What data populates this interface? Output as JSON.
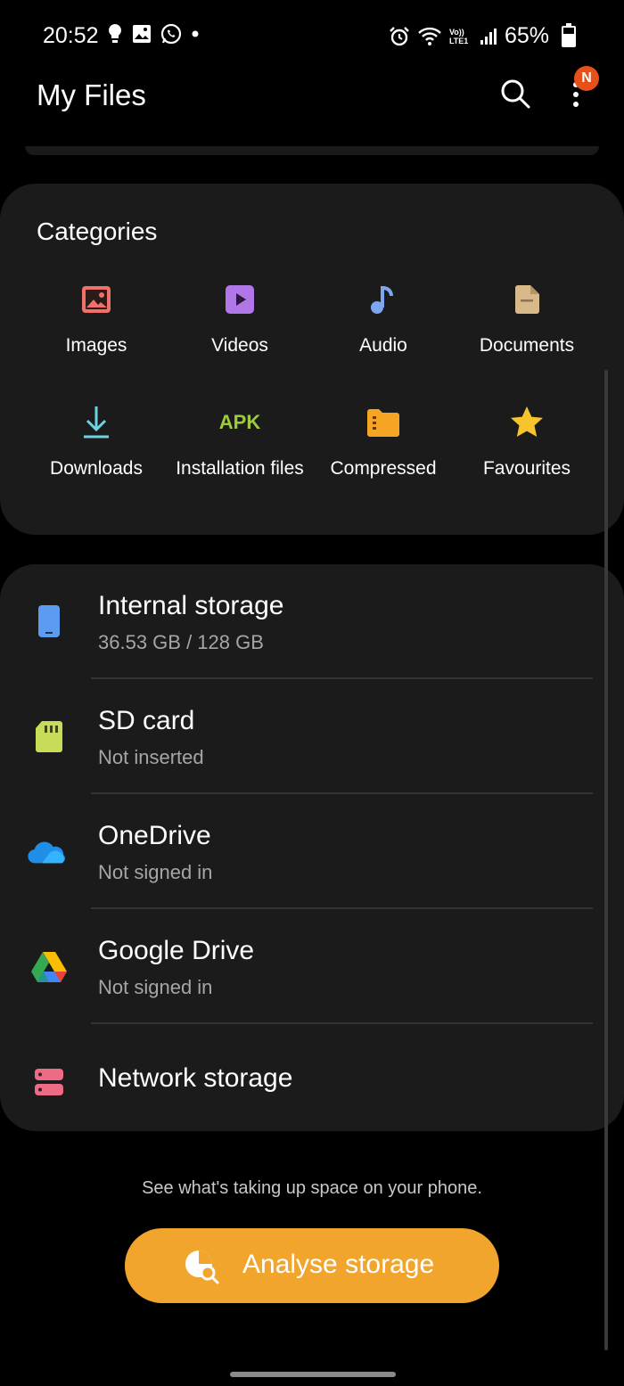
{
  "status_bar": {
    "time": "20:52",
    "battery": "65%",
    "battery_level": 0.65,
    "icons_left": [
      "bulb-icon",
      "gallery-icon",
      "whatsapp-icon",
      "dot-icon"
    ],
    "icons_right": [
      "alarm-icon",
      "wifi-icon",
      "volte-icon",
      "signal-icon",
      "battery-icon"
    ],
    "volte_text": "Vo)) LTE1"
  },
  "appbar": {
    "title": "My Files",
    "badge": "N"
  },
  "categories": {
    "title": "Categories",
    "items": [
      {
        "label": "Images",
        "icon": "image-icon",
        "color": "#f0706a"
      },
      {
        "label": "Videos",
        "icon": "video-icon",
        "color": "#b176e8"
      },
      {
        "label": "Audio",
        "icon": "music-note-icon",
        "color": "#7ea6f0"
      },
      {
        "label": "Documents",
        "icon": "document-icon",
        "color": "#d9b98a"
      },
      {
        "label": "Downloads",
        "icon": "download-icon",
        "color": "#6fd1e4"
      },
      {
        "label": "Installation files",
        "icon": "apk-icon",
        "color": "#9ccc3c",
        "icon_text": "APK"
      },
      {
        "label": "Compressed",
        "icon": "folder-zip-icon",
        "color": "#f5a423"
      },
      {
        "label": "Favourites",
        "icon": "star-icon",
        "color": "#f7c52b"
      }
    ]
  },
  "storage": [
    {
      "name": "Internal storage",
      "sub": "36.53 GB / 128 GB",
      "icon": "phone-icon",
      "color": "#5b9cf0"
    },
    {
      "name": "SD card",
      "sub": "Not inserted",
      "icon": "sd-card-icon",
      "color": "#c8dc5a"
    },
    {
      "name": "OneDrive",
      "sub": "Not signed in",
      "icon": "onedrive-icon",
      "color": "#1f8ee8"
    },
    {
      "name": "Google Drive",
      "sub": "Not signed in",
      "icon": "google-drive-icon",
      "color": "#34a853"
    },
    {
      "name": "Network storage",
      "sub": "",
      "icon": "network-storage-icon",
      "color": "#ee6b86"
    }
  ],
  "hint": "See what's taking up space on your phone.",
  "analyse_button": {
    "label": "Analyse storage",
    "color": "#f2a52c"
  }
}
